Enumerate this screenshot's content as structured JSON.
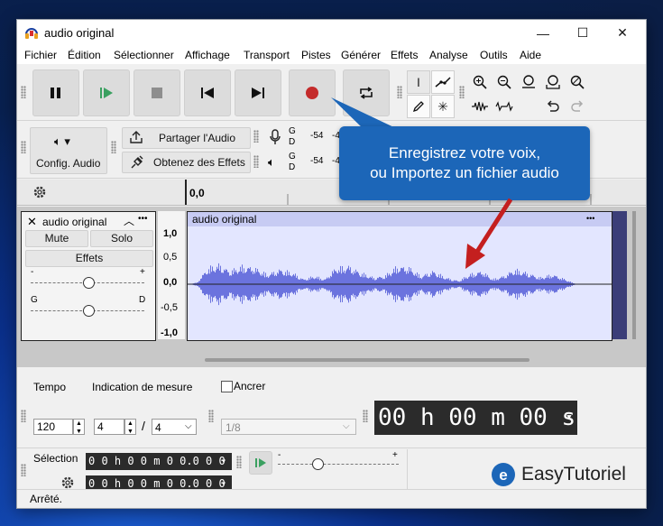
{
  "window": {
    "title": "audio original",
    "minimize": "—",
    "maximize": "☐",
    "close": "✕"
  },
  "menu": [
    "Fichier",
    "Édition",
    "Sélectionner",
    "Affichage",
    "Transport",
    "Pistes",
    "Générer",
    "Effets",
    "Analyse",
    "Outils",
    "Aide"
  ],
  "toolbar2": {
    "config_audio": "Config. Audio",
    "share_audio": "Partager l'Audio",
    "get_effects": "Obtenez des Effets",
    "meter_rec": {
      "g": "G",
      "d": "D",
      "val1": "-54",
      "val2": "-4"
    },
    "meter_play": {
      "g": "G",
      "d": "D",
      "val1": "-54",
      "val2": "-4"
    }
  },
  "ruler": {
    "start": "0,0"
  },
  "track": {
    "name": "audio original",
    "mute": "Mute",
    "solo": "Solo",
    "effects": "Effets",
    "gain_minus": "-",
    "gain_plus": "+",
    "pan_left": "G",
    "pan_right": "D",
    "clip_name": "audio original",
    "clip_menu": "•••",
    "scale": [
      "1,0",
      "0,5",
      "0,0",
      "-0,5",
      "-1,0"
    ]
  },
  "bottom": {
    "tempo_label": "Tempo",
    "tempo_value": "120",
    "signature_label": "Indication de mesure",
    "sig_num": "4",
    "sig_sep": "/",
    "sig_den": "4",
    "anchor_label": "Ancrer",
    "anchor_value": "1/8",
    "time_display": "00 h 00 m 00 s",
    "selection_label": "Sélection",
    "sel_start": "0 0 h 0 0 m 0 0.0 0 0 s",
    "sel_end": "0 0 h 0 0 m 0 0.0 0 0 s",
    "speed_minus": "-",
    "speed_plus": "+"
  },
  "status": "Arrêté.",
  "callout": {
    "line1": "Enregistrez votre voix,",
    "line2": "ou Importez un fichier audio"
  },
  "watermark": "EasyTutoriel",
  "colors": {
    "waveform": "#6b73de",
    "record": "#c42b2b",
    "play": "#3aa060",
    "callout": "#1c66b8",
    "arrow": "#c41f1f"
  }
}
